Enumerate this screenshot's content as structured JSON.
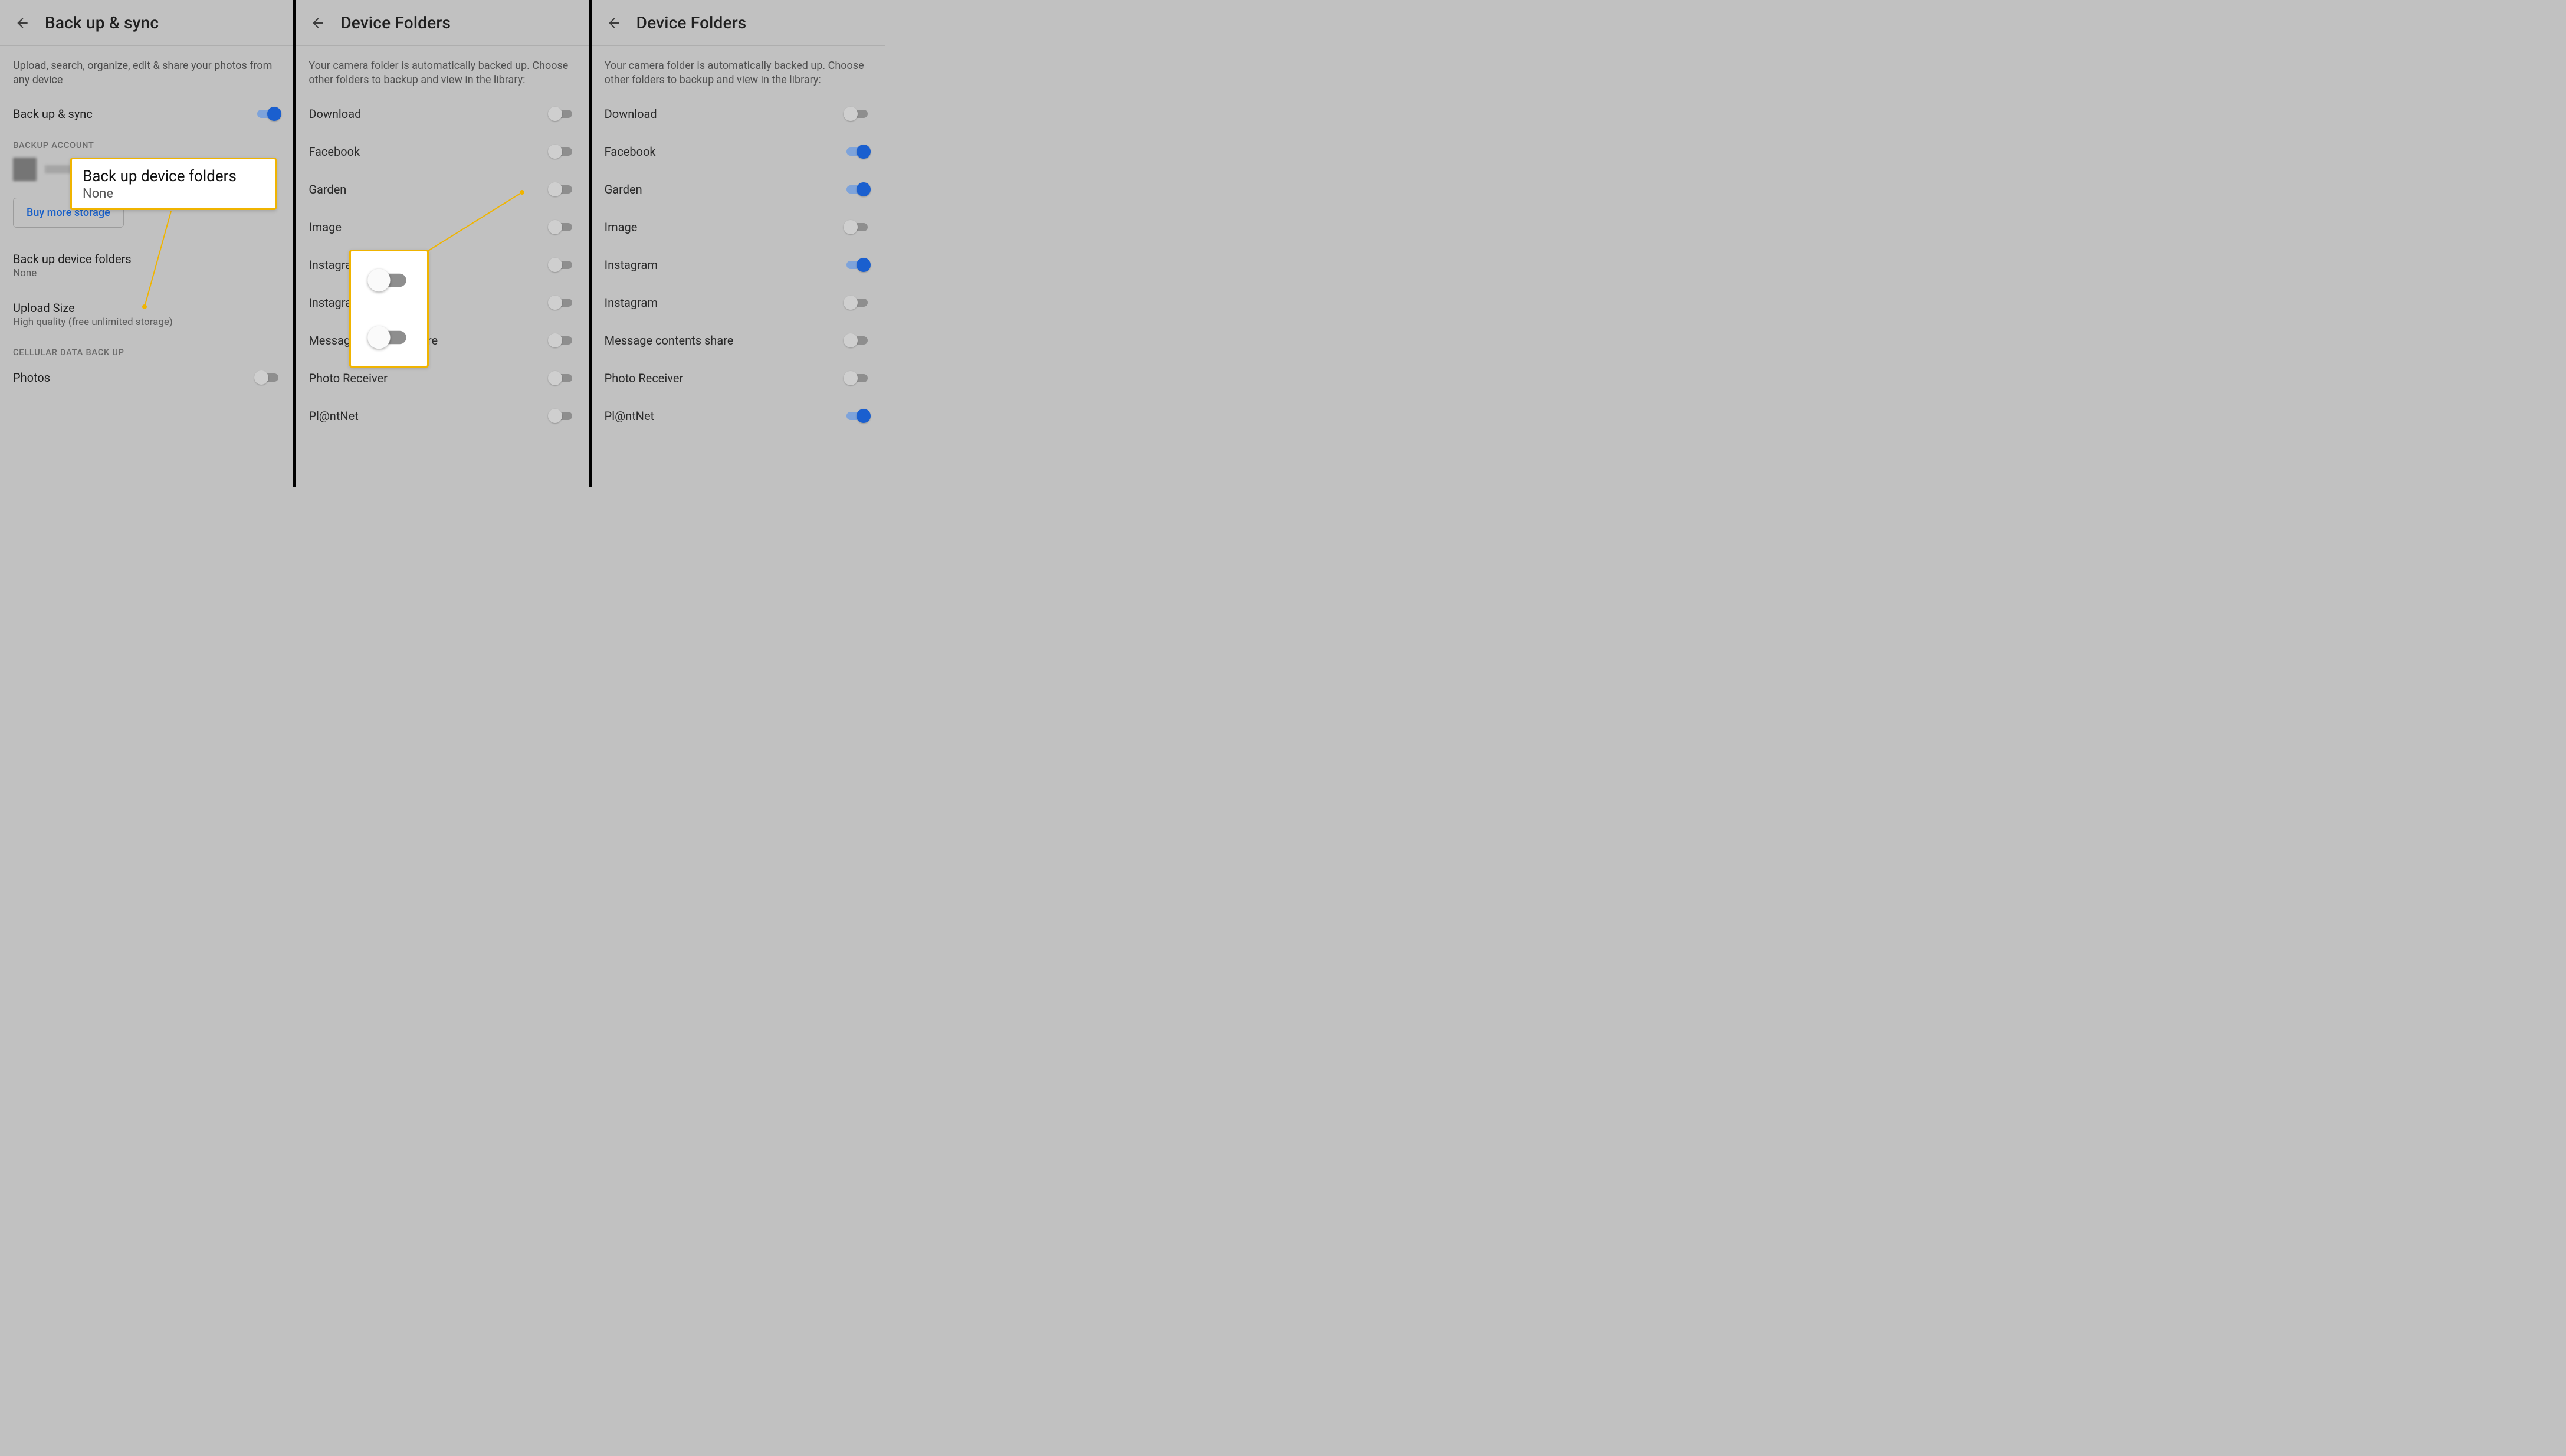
{
  "panel1": {
    "title": "Back up & sync",
    "description": "Upload, search, organize, edit & share your photos from any device",
    "backup_toggle_label": "Back up & sync",
    "backup_toggle_on": true,
    "section_backup_account": "BACKUP ACCOUNT",
    "buy_more_storage": "Buy more storage",
    "backup_device_folders": {
      "title": "Back up device folders",
      "value": "None"
    },
    "upload_size": {
      "title": "Upload Size",
      "value": "High quality (free unlimited storage)"
    },
    "section_cell": "CELLULAR DATA BACK UP",
    "cell_photos_label": "Photos",
    "cell_photos_on": false,
    "callout": {
      "title": "Back up device folders",
      "value": "None"
    }
  },
  "panel2": {
    "title": "Device Folders",
    "subhead": "Your camera folder is automatically backed up. Choose other folders to backup and view in the library:",
    "folders": [
      {
        "name": "Download",
        "on": false
      },
      {
        "name": "Facebook",
        "on": false
      },
      {
        "name": "Garden",
        "on": false
      },
      {
        "name": "Image",
        "on": false
      },
      {
        "name": "Instagram",
        "on": false
      },
      {
        "name": "Instagram",
        "on": false
      },
      {
        "name": "Message contents share",
        "on": false
      },
      {
        "name": "Photo Receiver",
        "on": false
      },
      {
        "name": "Pl@ntNet",
        "on": false
      }
    ]
  },
  "panel3": {
    "title": "Device Folders",
    "subhead": "Your camera folder is automatically backed up. Choose other folders to backup and view in the library:",
    "folders": [
      {
        "name": "Download",
        "on": false
      },
      {
        "name": "Facebook",
        "on": true
      },
      {
        "name": "Garden",
        "on": true
      },
      {
        "name": "Image",
        "on": false
      },
      {
        "name": "Instagram",
        "on": true
      },
      {
        "name": "Instagram",
        "on": false
      },
      {
        "name": "Message contents share",
        "on": false
      },
      {
        "name": "Photo Receiver",
        "on": false
      },
      {
        "name": "Pl@ntNet",
        "on": true
      }
    ]
  }
}
